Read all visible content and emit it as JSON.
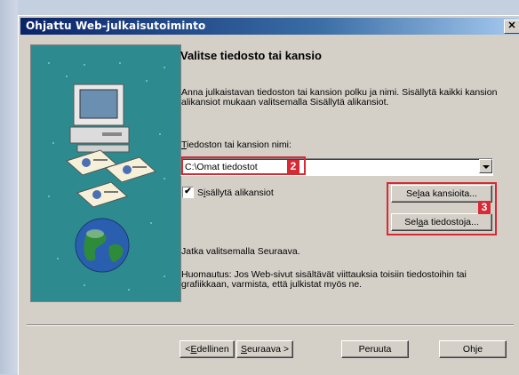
{
  "window": {
    "title": "Ohjattu Web-julkaisutoiminto",
    "close_glyph": "✕"
  },
  "heading": "Valitse tiedosto tai kansio",
  "description": "Anna julkaistavan tiedoston tai kansion polku ja nimi. Sisällytä kaikki kansion alikansiot mukaan valitsemalla Sisällytä alikansiot.",
  "path_field": {
    "label_mnemonic": "T",
    "label_rest": "iedoston tai kansion nimi:",
    "value": "C:\\Omat tiedostot"
  },
  "include_subfolders": {
    "checked_glyph": "✔",
    "label_pre": "S",
    "label_mn": "i",
    "label_post": "sällytä alikansiot"
  },
  "browse_folders": {
    "pre": "Se",
    "mn": "l",
    "post": "aa kansioita..."
  },
  "browse_files": {
    "pre": "Sel",
    "mn": "a",
    "post": "a tiedostoja..."
  },
  "info_next": "Jatka valitsemalla Seuraava.",
  "info_note": "Huomautus: Jos Web-sivut sisältävät viittauksia toisiin tiedostoihin tai grafiikkaan, varmista, että julkistat myös ne.",
  "badges": {
    "path": "2",
    "browse": "3"
  },
  "buttons": {
    "back": {
      "pre": "< ",
      "mn": "E",
      "post": "dellinen"
    },
    "next": {
      "mn": "S",
      "post": "euraava >"
    },
    "cancel": "Peruuta",
    "help": "Ohje"
  },
  "colors": {
    "highlight": "#d72a35",
    "title_start": "#0a246a",
    "art_bg": "#2d8b8f"
  },
  "icons": [
    "computer-icon",
    "documents-icon",
    "globe-icon"
  ]
}
